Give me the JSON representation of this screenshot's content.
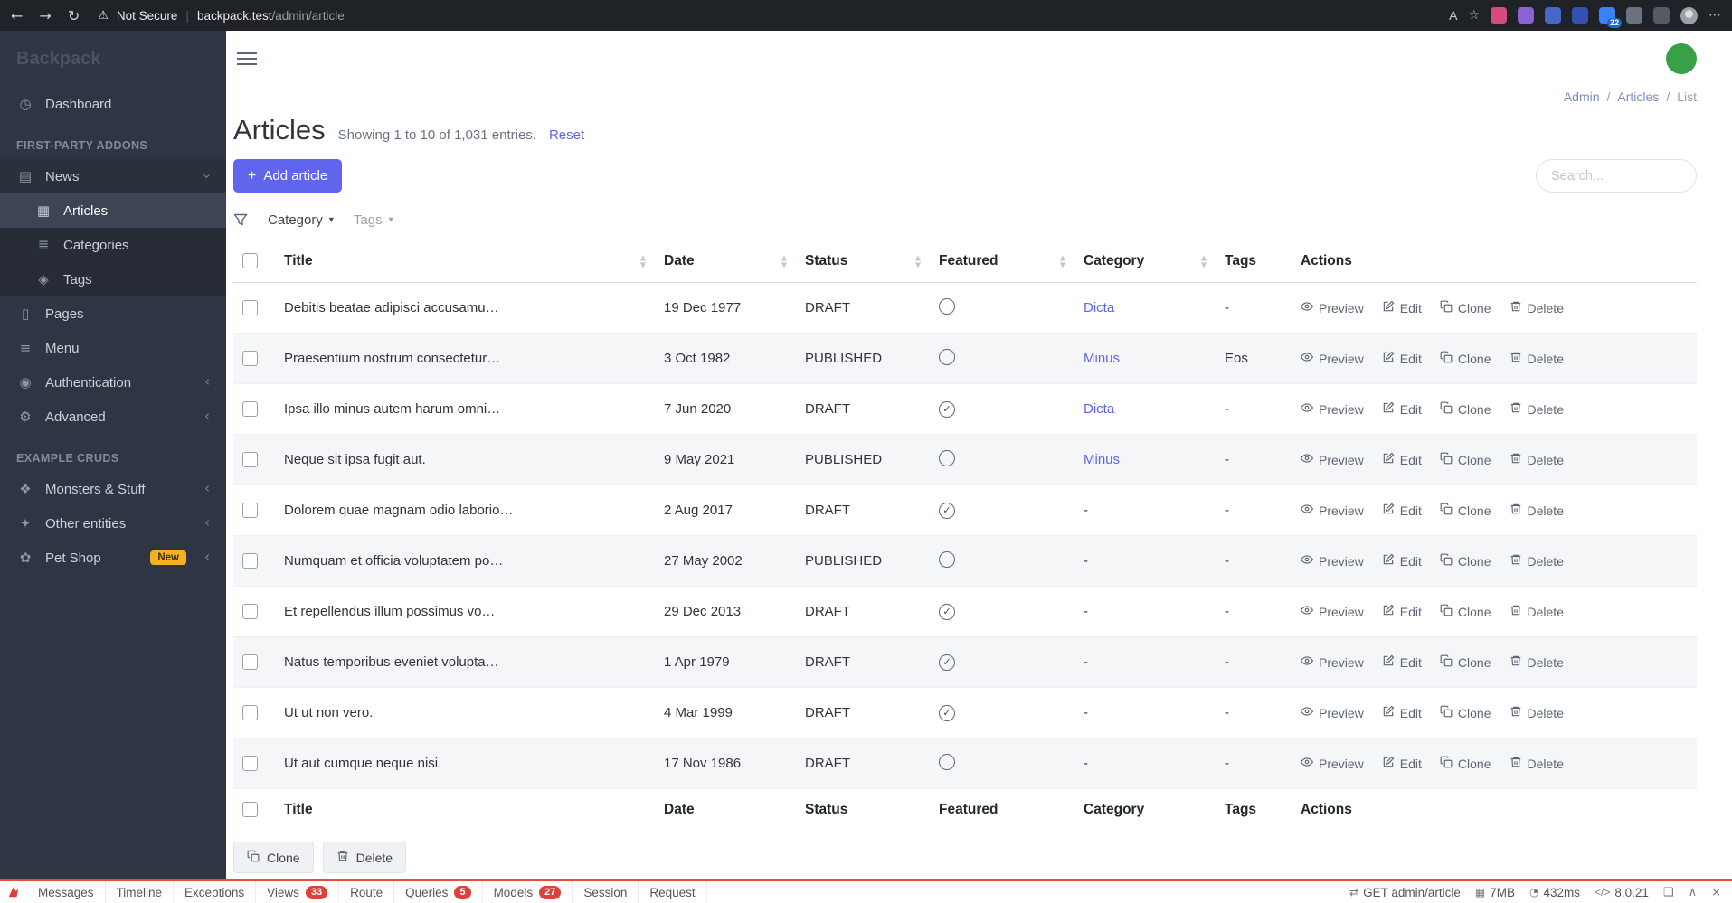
{
  "browser": {
    "security_label": "Not Secure",
    "url_host": "backpack.test",
    "url_path": "/admin/article",
    "extension_badge": "22"
  },
  "sidebar": {
    "logo": "Backpack",
    "items": [
      {
        "type": "link",
        "label": "Dashboard",
        "icon": "gauge-icon"
      },
      {
        "type": "section",
        "label": "FIRST-PARTY ADDONS"
      },
      {
        "type": "group",
        "label": "News",
        "icon": "newspaper-icon",
        "chevron": "down"
      },
      {
        "type": "sublink",
        "label": "Articles",
        "icon": "article-icon",
        "active": true
      },
      {
        "type": "sublink",
        "label": "Categories",
        "icon": "categories-icon"
      },
      {
        "type": "sublink",
        "label": "Tags",
        "icon": "tag-icon"
      },
      {
        "type": "link",
        "label": "Pages",
        "icon": "page-icon"
      },
      {
        "type": "link",
        "label": "Menu",
        "icon": "menu-icon"
      },
      {
        "type": "group",
        "label": "Authentication",
        "icon": "users-icon",
        "chevron": "left"
      },
      {
        "type": "group",
        "label": "Advanced",
        "icon": "advanced-icon",
        "chevron": "left"
      },
      {
        "type": "section",
        "label": "EXAMPLE CRUDS"
      },
      {
        "type": "group",
        "label": "Monsters & Stuff",
        "icon": "monster-icon",
        "chevron": "left"
      },
      {
        "type": "group",
        "label": "Other entities",
        "icon": "entities-icon",
        "chevron": "left"
      },
      {
        "type": "group",
        "label": "Pet Shop",
        "icon": "paw-icon",
        "badge": "New",
        "chevron": "left"
      }
    ]
  },
  "breadcrumb": {
    "separator": "/",
    "items": [
      {
        "label": "Admin",
        "link": true
      },
      {
        "label": "Articles",
        "link": true
      },
      {
        "label": "List",
        "link": false
      }
    ]
  },
  "page": {
    "title": "Articles",
    "subtitle": "Showing 1 to 10 of 1,031 entries.",
    "reset_label": "Reset",
    "add_button": "Add article",
    "search_placeholder": "Search...",
    "filters": [
      {
        "label": "Category",
        "muted": false
      },
      {
        "label": "Tags",
        "muted": true
      }
    ]
  },
  "table": {
    "columns": [
      "Title",
      "Date",
      "Status",
      "Featured",
      "Category",
      "Tags",
      "Actions"
    ],
    "sortable": [
      "Title",
      "Date",
      "Status",
      "Featured",
      "Category"
    ],
    "actions": [
      "Preview",
      "Edit",
      "Clone",
      "Delete"
    ],
    "rows": [
      {
        "title": "Debitis beatae adipisci accusamu…",
        "date": "19 Dec 1977",
        "status": "DRAFT",
        "featured": false,
        "category": "Dicta",
        "category_link": true,
        "tags": "-"
      },
      {
        "title": "Praesentium nostrum consectetur…",
        "date": "3 Oct 1982",
        "status": "PUBLISHED",
        "featured": false,
        "category": "Minus",
        "category_link": true,
        "tags": "Eos"
      },
      {
        "title": "Ipsa illo minus autem harum omni…",
        "date": "7 Jun 2020",
        "status": "DRAFT",
        "featured": true,
        "category": "Dicta",
        "category_link": true,
        "tags": "-"
      },
      {
        "title": "Neque sit ipsa fugit aut.",
        "date": "9 May 2021",
        "status": "PUBLISHED",
        "featured": false,
        "category": "Minus",
        "category_link": true,
        "tags": "-"
      },
      {
        "title": "Dolorem quae magnam odio laborio…",
        "date": "2 Aug 2017",
        "status": "DRAFT",
        "featured": true,
        "category": "-",
        "category_link": false,
        "tags": "-"
      },
      {
        "title": "Numquam et officia voluptatem po…",
        "date": "27 May 2002",
        "status": "PUBLISHED",
        "featured": false,
        "category": "-",
        "category_link": false,
        "tags": "-"
      },
      {
        "title": "Et repellendus illum possimus vo…",
        "date": "29 Dec 2013",
        "status": "DRAFT",
        "featured": true,
        "category": "-",
        "category_link": false,
        "tags": "-"
      },
      {
        "title": "Natus temporibus eveniet volupta…",
        "date": "1 Apr 1979",
        "status": "DRAFT",
        "featured": true,
        "category": "-",
        "category_link": false,
        "tags": "-"
      },
      {
        "title": "Ut ut non vero.",
        "date": "4 Mar 1999",
        "status": "DRAFT",
        "featured": true,
        "category": "-",
        "category_link": false,
        "tags": "-"
      },
      {
        "title": "Ut aut cumque neque nisi.",
        "date": "17 Nov 1986",
        "status": "DRAFT",
        "featured": false,
        "category": "-",
        "category_link": false,
        "tags": "-"
      }
    ]
  },
  "bulk_actions": {
    "clone": "Clone",
    "delete": "Delete"
  },
  "debugbar": {
    "tabs": [
      {
        "label": "Messages"
      },
      {
        "label": "Timeline"
      },
      {
        "label": "Exceptions"
      },
      {
        "label": "Views",
        "badge": "33"
      },
      {
        "label": "Route"
      },
      {
        "label": "Queries",
        "badge": "5"
      },
      {
        "label": "Models",
        "badge": "27"
      },
      {
        "label": "Session"
      },
      {
        "label": "Request"
      }
    ],
    "request": "GET admin/article",
    "memory": "7MB",
    "time": "432ms",
    "php_version": "8.0.21"
  },
  "colors": {
    "accent": "#6065ee",
    "sidebar_bg": "#2f3542",
    "badge_red": "#e0403a",
    "badge_new_bg": "#f6b024",
    "avatar_green": "#38a047"
  }
}
